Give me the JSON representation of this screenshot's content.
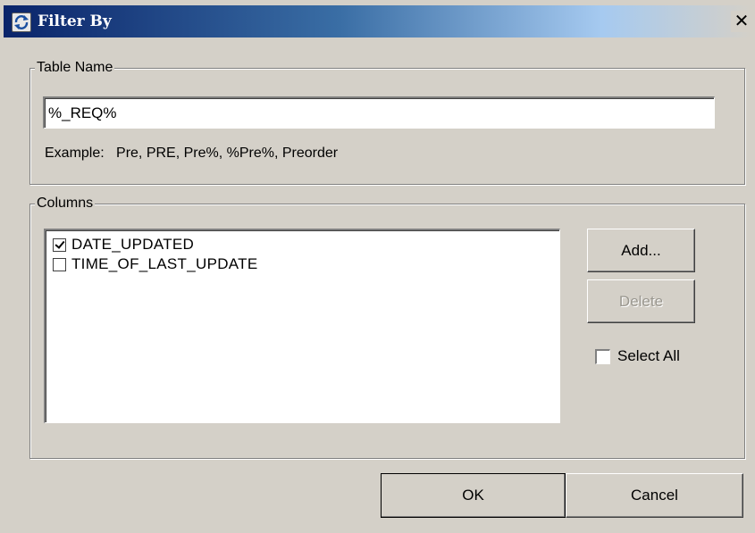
{
  "window": {
    "title": "Filter By",
    "close_glyph": "✕"
  },
  "table_name": {
    "group_label": "Table Name",
    "value": "%_REQ%",
    "example": "Example:   Pre, PRE, Pre%, %Pre%, Preorder"
  },
  "columns": {
    "group_label": "Columns",
    "items": [
      {
        "label": "DATE_UPDATED",
        "checked": true
      },
      {
        "label": "TIME_OF_LAST_UPDATE",
        "checked": false
      }
    ],
    "add_label": "Add...",
    "delete_label": "Delete",
    "select_all_label": "Select All",
    "select_all_checked": false
  },
  "footer": {
    "ok_label": "OK",
    "cancel_label": "Cancel"
  },
  "icons": {
    "title": "refresh-icon"
  },
  "colors": {
    "face": "#d4d0c8",
    "title_start": "#0a246a",
    "title_end": "#a6caf0"
  }
}
